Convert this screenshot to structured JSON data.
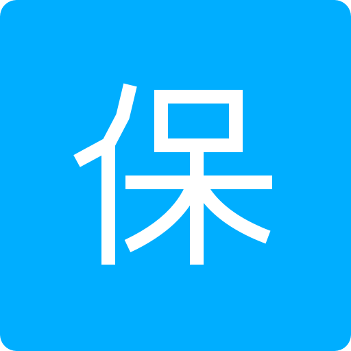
{
  "app_icon": {
    "glyph": "保",
    "background_color": "#00AEFF",
    "glyph_color": "#FFFFFF"
  }
}
